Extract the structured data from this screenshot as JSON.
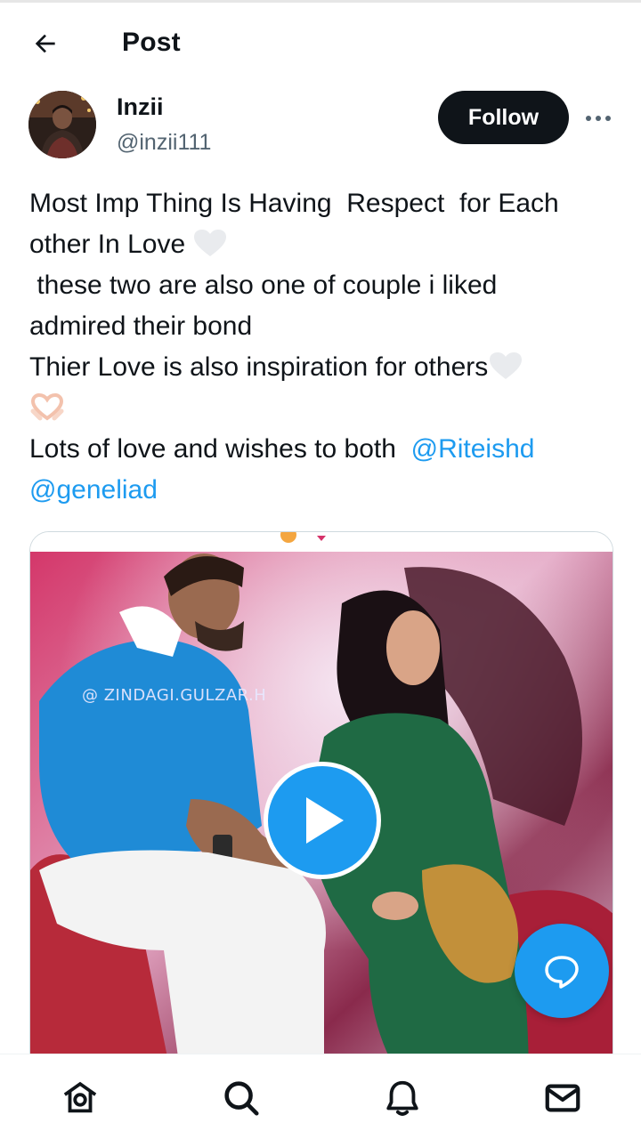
{
  "header": {
    "title": "Post",
    "back_icon": "arrow-left-icon"
  },
  "author": {
    "name": "Inzii",
    "handle": "@inzii111",
    "follow_label": "Follow",
    "more_icon": "more-horizontal-icon"
  },
  "tweet": {
    "lines": [
      "Most Imp Thing Is Having  Respect  for Each",
      "other In Love",
      " these two are also one of couple i liked",
      "admired their bond",
      "Thier Love is also inspiration for others",
      "",
      "Lots of love and wishes to both  ",
      ""
    ],
    "mentions": [
      "@Riteishd",
      "@geneliad"
    ],
    "emojis": [
      "white-heart-icon",
      "white-heart-icon",
      "heart-hands-icon"
    ]
  },
  "media": {
    "watermark": "@ ZINDAGI.GULZAR.H",
    "play_icon": "play-icon"
  },
  "fab": {
    "icon": "reply-bubble-icon"
  },
  "bottom_nav": [
    {
      "icon": "home-icon"
    },
    {
      "icon": "search-icon"
    },
    {
      "icon": "bell-icon"
    },
    {
      "icon": "mail-icon"
    }
  ],
  "colors": {
    "accent": "#1d9bf0",
    "text": "#0f1419",
    "secondary_text": "#536471",
    "follow_bg": "#0f1419"
  }
}
